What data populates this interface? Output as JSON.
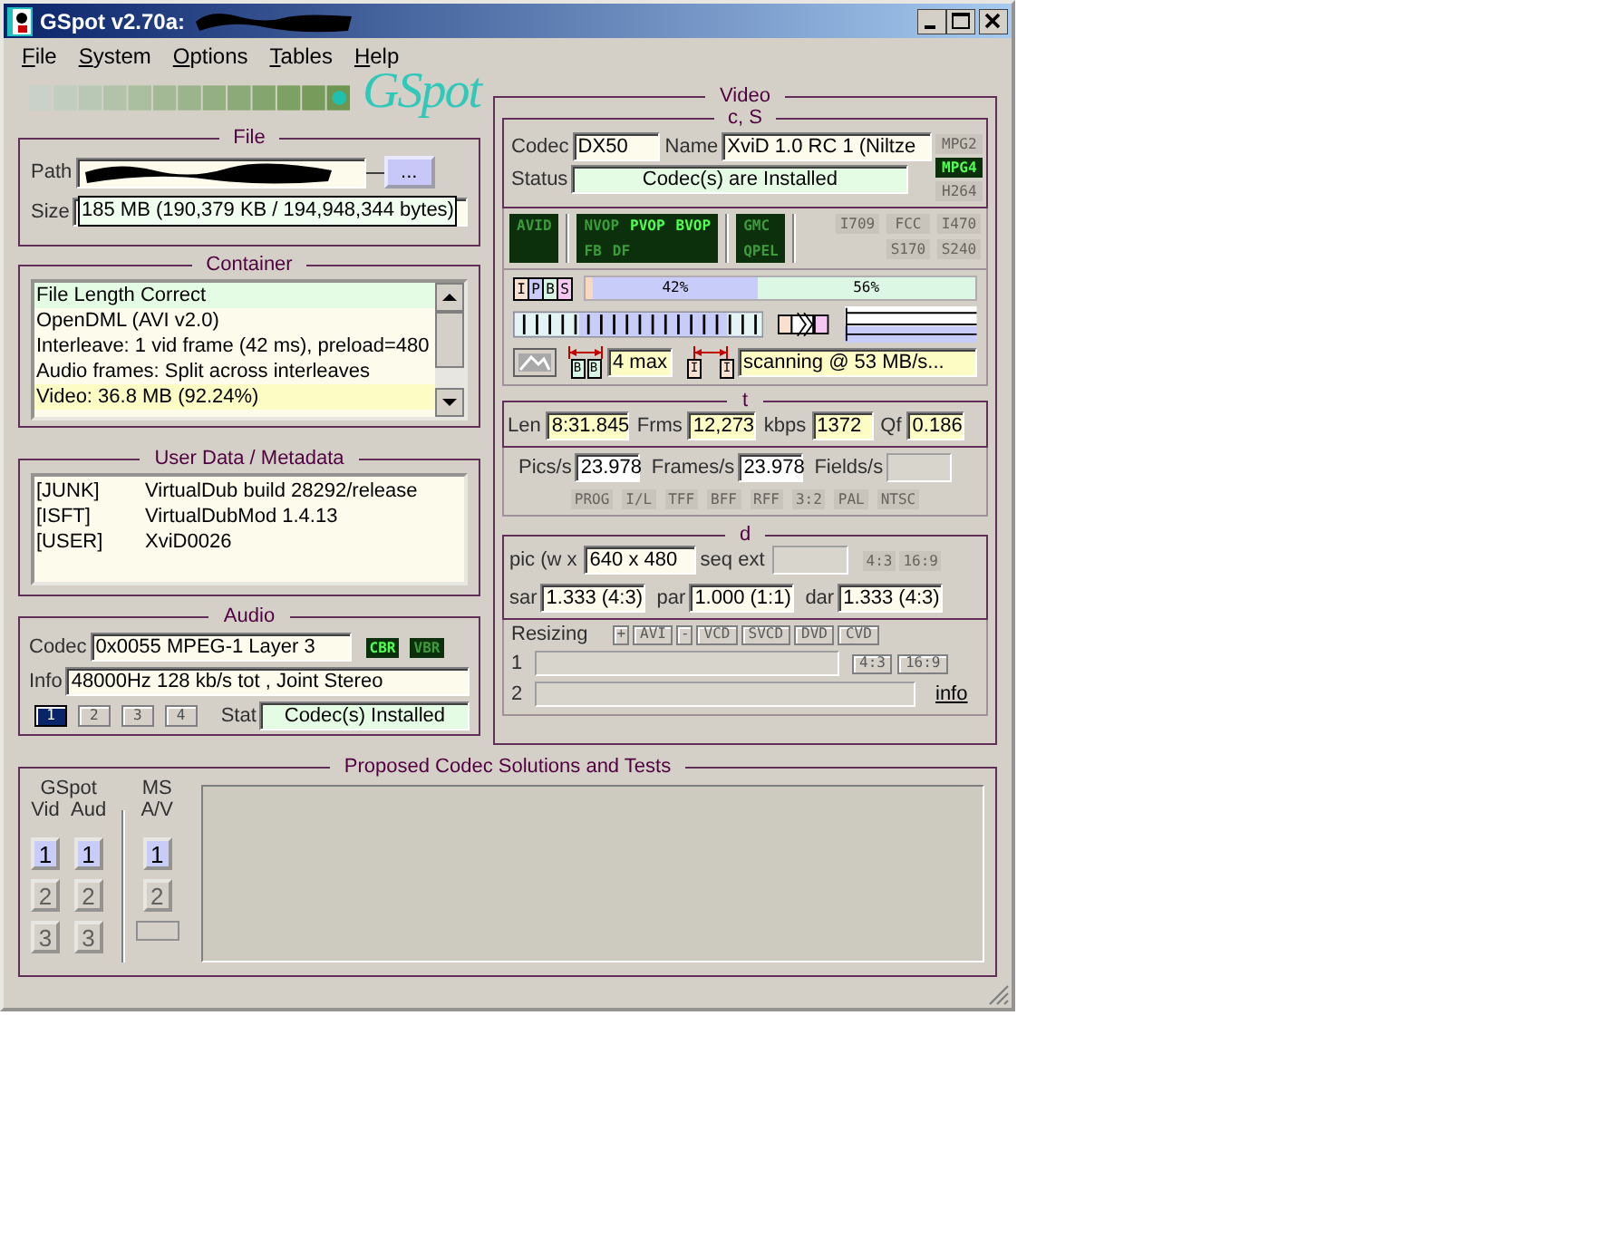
{
  "window": {
    "title": "GSpot v2.70a:"
  },
  "menu": [
    {
      "label": "File"
    },
    {
      "label": "System"
    },
    {
      "label": "Options"
    },
    {
      "label": "Tables"
    },
    {
      "label": "Help"
    }
  ],
  "logo": {
    "text": "GSpot"
  },
  "file": {
    "title": "File",
    "path_label": "Path",
    "browse_button": "...",
    "size_label": "Size",
    "size_tooltip": "185 MB (190,379 KB / 194,948,344 bytes)"
  },
  "container": {
    "title": "Container",
    "lines": [
      {
        "text": "File Length Correct",
        "kind": "ok"
      },
      {
        "text": "OpenDML (AVI v2.0)",
        "kind": "plain"
      },
      {
        "text": "Interleave: 1 vid frame (42 ms), preload=480",
        "kind": "plain"
      },
      {
        "text": "Audio frames: Split across interleaves",
        "kind": "plain"
      },
      {
        "text": "Video: 36.8 MB (92.24%)",
        "kind": "highlight"
      }
    ]
  },
  "user_data": {
    "title": "User Data / Metadata",
    "entries": [
      {
        "tag": "[JUNK]",
        "value": "VirtualDub build 28292/release"
      },
      {
        "tag": "[ISFT]",
        "value": "VirtualDubMod 1.4.13"
      },
      {
        "tag": "[USER]",
        "value": "XviD0026"
      }
    ]
  },
  "audio": {
    "title": "Audio",
    "codec_label": "Codec",
    "codec": "0x0055 MPEG-1 Layer 3",
    "modes": [
      {
        "label": "CBR",
        "on": true
      },
      {
        "label": "VBR",
        "on": false
      }
    ],
    "info_label": "Info",
    "info": "48000Hz  128 kb/s tot , Joint Stereo",
    "streams": [
      {
        "label": "1",
        "selected": true
      },
      {
        "label": "2",
        "selected": false
      },
      {
        "label": "3",
        "selected": false
      },
      {
        "label": "4",
        "selected": false
      }
    ],
    "stat_label": "Stat",
    "stat": "Codec(s) Installed"
  },
  "video": {
    "title": "Video",
    "cs": {
      "title": "c, S",
      "codec_label": "Codec",
      "codec": "DX50",
      "name_label": "Name",
      "name": "XviD 1.0 RC 1 (Niltze",
      "status_label": "Status",
      "status": "Codec(s) are Installed",
      "formats": [
        {
          "label": "MPG2",
          "on": false
        },
        {
          "label": "MPG4",
          "on": true
        },
        {
          "label": "H264",
          "on": false
        }
      ]
    },
    "flag_groups": [
      {
        "kind": "led",
        "rows": [
          [
            {
              "label": "AVID",
              "on": false
            }
          ]
        ]
      },
      {
        "kind": "led",
        "rows": [
          [
            {
              "label": "NVOP",
              "on": false
            },
            {
              "label": "PVOP",
              "on": true
            },
            {
              "label": "BVOP",
              "on": true
            }
          ],
          [
            {
              "label": "FB",
              "on": false
            },
            {
              "label": "DF",
              "on": false
            }
          ]
        ]
      },
      {
        "kind": "led",
        "rows": [
          [
            {
              "label": "GMC",
              "on": false
            }
          ],
          [
            {
              "label": "QPEL",
              "on": false
            }
          ]
        ]
      },
      {
        "kind": "plain",
        "rows": [
          [
            {
              "label": "I709",
              "on": false
            },
            {
              "label": "FCC",
              "on": false
            },
            {
              "label": "I470",
              "on": false
            }
          ],
          [
            null,
            {
              "label": "S170",
              "on": false
            },
            {
              "label": "S240",
              "on": false
            }
          ]
        ]
      }
    ],
    "frame_types": {
      "letters": [
        {
          "label": "I",
          "color": "#f8e0d0"
        },
        {
          "label": "P",
          "color": "#c8ccf8"
        },
        {
          "label": "B",
          "color": "#d8f4e4"
        },
        {
          "label": "S",
          "color": "#f4c8f0"
        }
      ],
      "segments": [
        {
          "level": 0.02,
          "color": "#f8d8c0"
        },
        {
          "label": "42%",
          "level": 0.42,
          "color": "#c8ccf8"
        },
        {
          "label": "56%",
          "level": 0.56,
          "color": "#dcf8e4"
        }
      ]
    },
    "bframes": {
      "letters": [
        "B",
        "B"
      ],
      "value": "4 max"
    },
    "iframes": {
      "letters": [
        "I",
        "I"
      ],
      "value": "scanning @ 53 MB/s..."
    },
    "t": {
      "title": "t",
      "fields": [
        {
          "label": "Len",
          "value": "8:31.845"
        },
        {
          "label": "Frms",
          "value": "12,273"
        },
        {
          "label": "kbps",
          "value": "1372"
        },
        {
          "label": "Qf",
          "value": "0.186"
        }
      ]
    },
    "rates": {
      "fields": [
        {
          "label": "Pics/s",
          "value": "23.978"
        },
        {
          "label": "Frames/s",
          "value": "23.978"
        },
        {
          "label": "Fields/s"
        }
      ],
      "flags": [
        {
          "label": "PROG",
          "on": false
        },
        {
          "label": "I/L",
          "on": false
        },
        {
          "label": "TFF",
          "on": false
        },
        {
          "label": "BFF",
          "on": false
        },
        {
          "label": "RFF",
          "on": false
        },
        {
          "label": "3:2",
          "on": false
        },
        {
          "label": "PAL",
          "on": false
        },
        {
          "label": "NTSC",
          "on": false
        }
      ]
    },
    "d": {
      "title": "d",
      "pic_label": "pic (w x",
      "pic": "640 x 480",
      "seq_label": "seq ext",
      "aspect_buttons": [
        {
          "label": "4:3",
          "on": false
        },
        {
          "label": "16:9",
          "on": false
        }
      ],
      "ratios": [
        {
          "label": "sar",
          "value": "1.333 (4:3)"
        },
        {
          "label": "par",
          "value": "1.000 (1:1)"
        },
        {
          "label": "dar",
          "value": "1.333 (4:3)"
        }
      ]
    },
    "resizing": {
      "label": "Resizing",
      "buttons": [
        "+",
        "AVI",
        "-",
        "VCD",
        "SVCD",
        "DVD",
        "CVD"
      ],
      "rows": [
        {
          "label": "1"
        },
        {
          "label": "2"
        }
      ],
      "aspect_buttons": [
        "4:3",
        "16:9"
      ],
      "info_link": "info"
    }
  },
  "proposed": {
    "title": "Proposed Codec Solutions and Tests",
    "gspot_label": "GSpot",
    "ms_label": "MS",
    "columns": [
      {
        "heading": "Vid",
        "buttons": [
          {
            "label": "1",
            "selected": true
          },
          {
            "label": "2",
            "selected": false
          },
          {
            "label": "3",
            "selected": false
          }
        ]
      },
      {
        "heading": "Aud",
        "buttons": [
          {
            "label": "1",
            "selected": true
          },
          {
            "label": "2",
            "selected": false
          },
          {
            "label": "3",
            "selected": false
          }
        ]
      },
      {
        "heading": "A/V",
        "blank_slot": true,
        "buttons": [
          {
            "label": "1",
            "selected": true
          },
          {
            "label": "2",
            "selected": false
          }
        ]
      }
    ]
  }
}
